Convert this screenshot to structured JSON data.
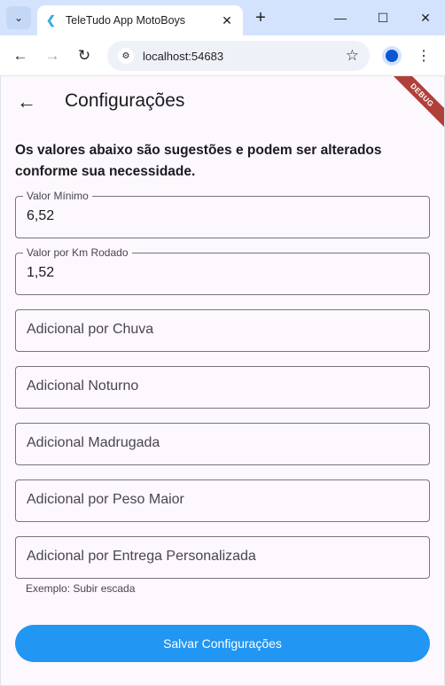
{
  "browser": {
    "tab_menu_icon": "chevron-down-icon",
    "tab_title": "TeleTudo App MotoBoys",
    "tab_close_glyph": "✕",
    "new_tab_glyph": "+",
    "url": "localhost:54683",
    "window_controls": [
      "minimize",
      "maximize",
      "close"
    ]
  },
  "app": {
    "debug_label": "DEBUG",
    "page_title": "Configurações",
    "intro_text": "Os valores abaixo são sugestões e podem ser alterados conforme sua necessidade.",
    "fields": [
      {
        "label": "Valor Mínimo",
        "value": "6,52"
      },
      {
        "label": "Valor por Km Rodado",
        "value": "1,52"
      },
      {
        "placeholder": "Adicional por Chuva"
      },
      {
        "placeholder": "Adicional Noturno"
      },
      {
        "placeholder": "Adicional Madrugada"
      },
      {
        "placeholder": "Adicional por Peso Maior"
      },
      {
        "placeholder": "Adicional por Entrega Personalizada",
        "helper": "Exemplo: Subir escada"
      }
    ],
    "save_label": "Salvar Configurações",
    "accent_color": "#2196f3"
  }
}
